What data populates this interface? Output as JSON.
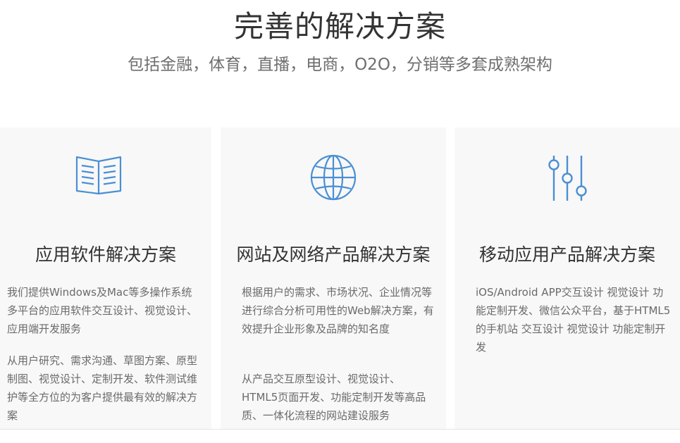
{
  "header": {
    "title": "完善的解决方案",
    "subtitle": "包括金融，体育，直播，电商，O2O，分销等多套成熟架构"
  },
  "cards": [
    {
      "title": "应用软件解决方案",
      "icon": "open-book-icon",
      "paragraphs": [
        "我们提供Windows及Mac等多操作系统多平台的应用软件交互设计、视觉设计、应用端开发服务",
        "从用户研究、需求沟通、草图方案、原型制图、视觉设计、定制开发、软件测试维护等全方位的为客户提供最有效的解决方案"
      ]
    },
    {
      "title": "网站及网络产品解决方案",
      "icon": "globe-icon",
      "paragraphs": [
        "根据用户的需求、市场状况、企业情况等进行综合分析可用性的Web解决方案，有效提升企业形象及品牌的知名度",
        "从产品交互原型设计、视觉设计、HTML5页面开发、功能定制开发等高品质、一体化流程的网站建设服务"
      ]
    },
    {
      "title": "移动应用产品解决方案",
      "icon": "sliders-icon",
      "paragraphs": [
        "iOS/Android APP交互设计 视觉设计 功能定制开发、微信公众平台，基于HTML5的手机站 交互设计 视觉设计 功能定制开发"
      ]
    }
  ],
  "colors": {
    "icon_blue": "#4a8fd4",
    "card_bg": "#f8f8f8",
    "title_text": "#333333",
    "body_text": "#6a6a6a"
  }
}
